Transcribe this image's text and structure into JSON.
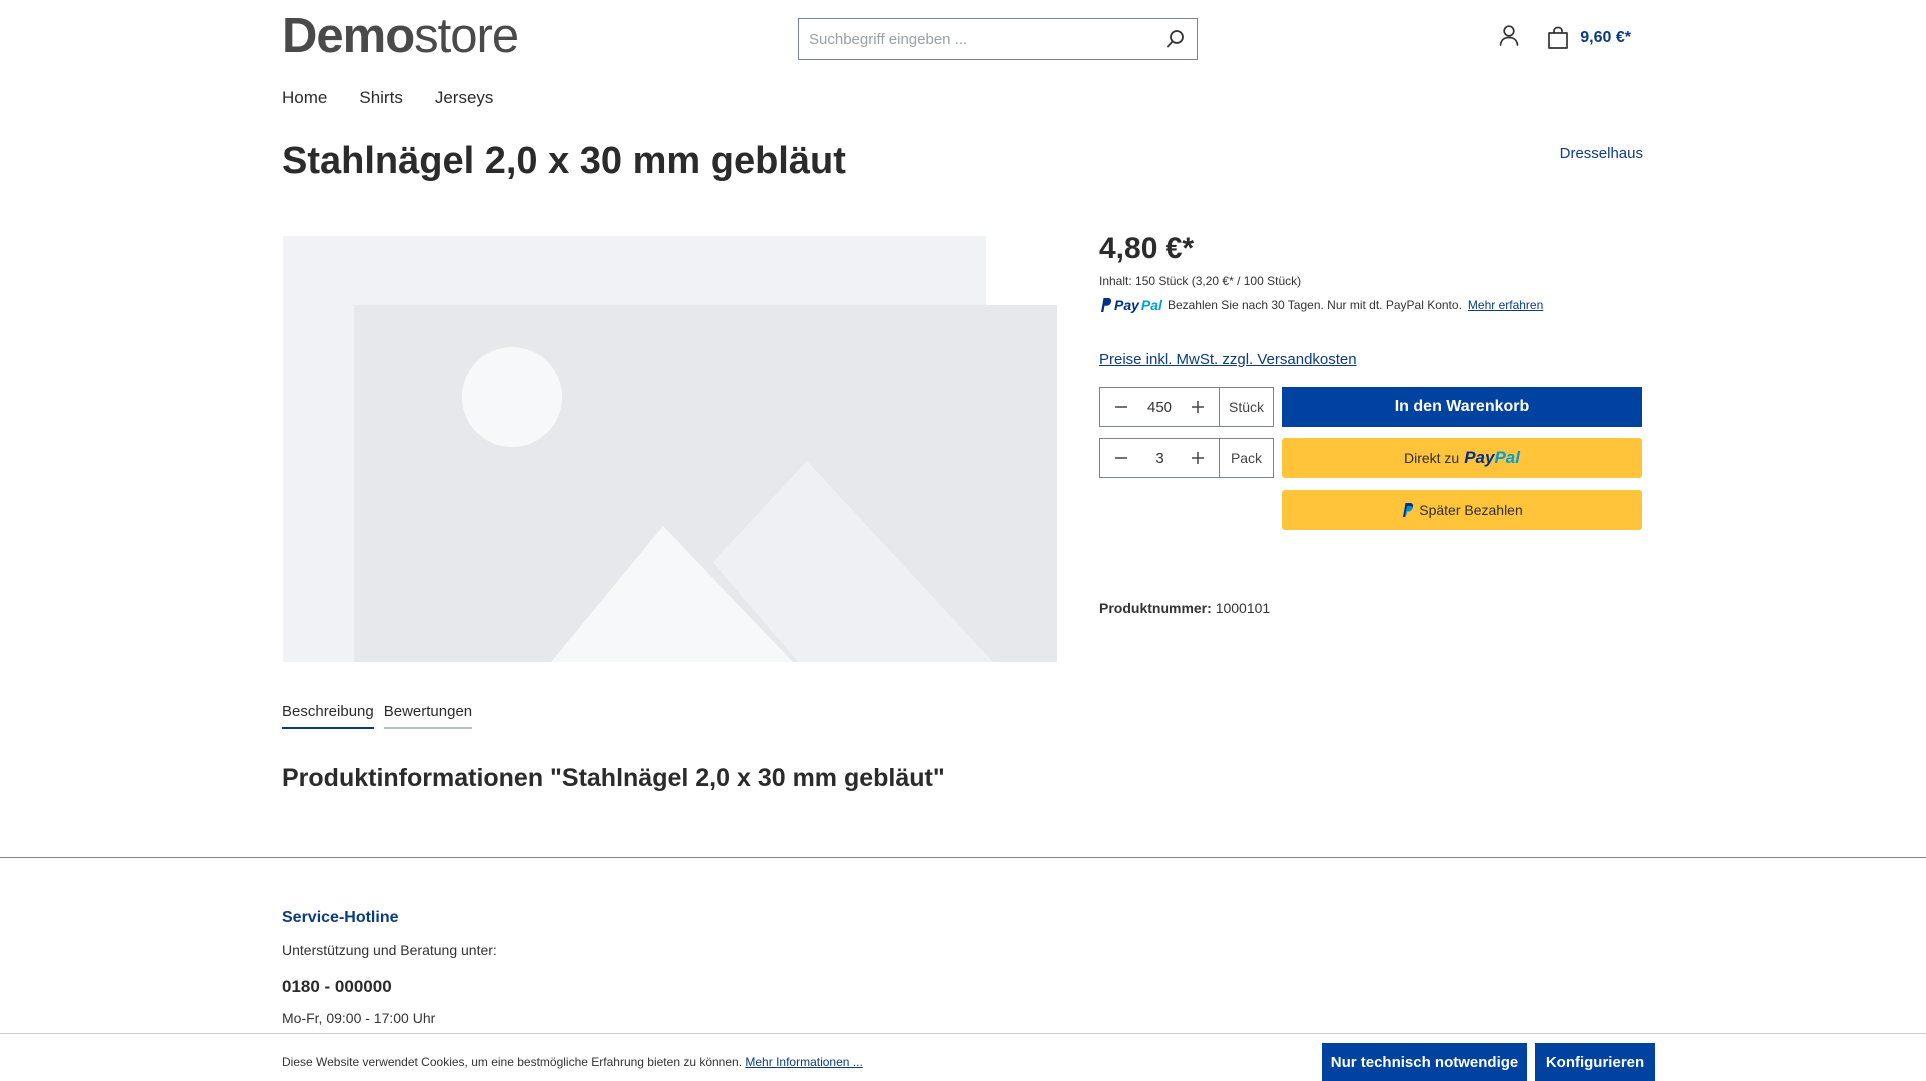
{
  "header": {
    "logo_bold": "Demo",
    "logo_light": "store",
    "search_placeholder": "Suchbegriff eingeben ...",
    "cart_total": "9,60 €*"
  },
  "nav": {
    "items": [
      {
        "label": "Home"
      },
      {
        "label": "Shirts"
      },
      {
        "label": "Jerseys"
      }
    ]
  },
  "product": {
    "title": "Stahlnägel 2,0 x 30 mm gebläut",
    "manufacturer": "Dresselhaus",
    "price": "4,80 €*",
    "unit_info": "Inhalt: 150 Stück (3,20 €* / 100 Stück)",
    "paypal_logo_a": "Pay",
    "paypal_logo_b": "Pal",
    "paypal_message": "Bezahlen Sie nach 30 Tagen. Nur mit dt. PayPal Konto.",
    "paypal_more": "Mehr erfahren",
    "shipping_link": "Preise inkl. MwSt. zzgl. Versandkosten",
    "qty1": {
      "value": "450",
      "unit": "Stück"
    },
    "qty2": {
      "value": "3",
      "unit": "Pack"
    },
    "add_to_cart": "In den Warenkorb",
    "paypal_direct_prefix": "Direkt zu",
    "paypal_later": "Später Bezahlen",
    "sku_label": "Produktnummer:",
    "sku_value": "1000101"
  },
  "tabs": [
    {
      "label": "Beschreibung",
      "active": true
    },
    {
      "label": "Bewertungen",
      "active": false
    }
  ],
  "section_title": "Produktinformationen \"Stahlnägel 2,0 x 30 mm gebläut\"",
  "footer": {
    "hotline_title": "Service-Hotline",
    "hotline_text": "Unterstützung und Beratung unter:",
    "hotline_phone": "0180 - 000000",
    "hotline_hours": "Mo-Fr, 09:00 - 17:00 Uhr"
  },
  "cookie": {
    "text": "Diese Website verwendet Cookies, um eine bestmögliche Erfahrung bieten zu können.",
    "link": "Mehr Informationen ...",
    "btn_necessary": "Nur technisch notwendige",
    "btn_configure": "Konfigurieren"
  },
  "colors": {
    "brand_blue": "#0042a0",
    "link_blue": "#0b3b80",
    "paypal_yellow": "#ffc439"
  }
}
